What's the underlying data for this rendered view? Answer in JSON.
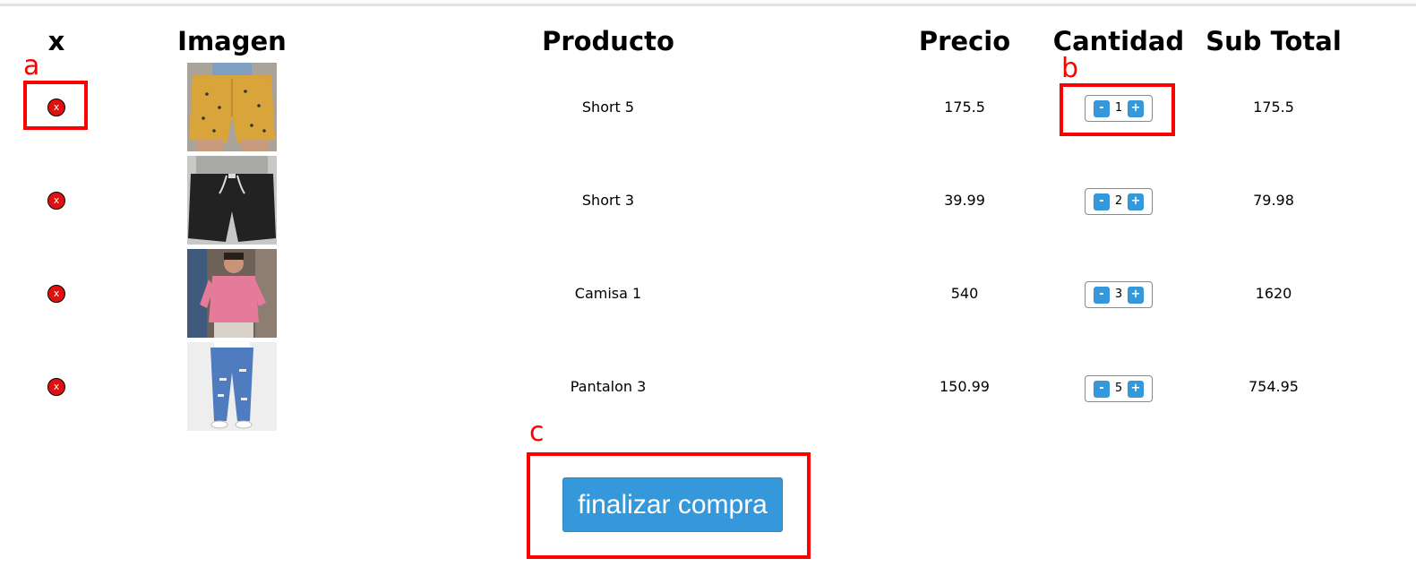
{
  "table": {
    "headers": {
      "remove": "x",
      "image": "Imagen",
      "product": "Producto",
      "price": "Precio",
      "quantity": "Cantidad",
      "subtotal": "Sub Total"
    },
    "rows": [
      {
        "remove_label": "x",
        "product": "Short 5",
        "price": "175.5",
        "quantity": "1",
        "subtotal": "175.5",
        "image_icon": "yellow-shorts-photo"
      },
      {
        "remove_label": "x",
        "product": "Short 3",
        "price": "39.99",
        "quantity": "2",
        "subtotal": "79.98",
        "image_icon": "black-shorts-photo"
      },
      {
        "remove_label": "x",
        "product": "Camisa 1",
        "price": "540",
        "quantity": "3",
        "subtotal": "1620",
        "image_icon": "pink-shirt-photo"
      },
      {
        "remove_label": "x",
        "product": "Pantalon 3",
        "price": "150.99",
        "quantity": "5",
        "subtotal": "754.95",
        "image_icon": "blue-jeans-photo"
      }
    ],
    "qty_minus": "-",
    "qty_plus": "+"
  },
  "checkout_button": "finalizar compra",
  "annotations": {
    "a": "a",
    "b": "b",
    "c": "c"
  },
  "colors": {
    "accent": "#3598db",
    "remove": "#e01010",
    "annotation": "#ff0000"
  }
}
